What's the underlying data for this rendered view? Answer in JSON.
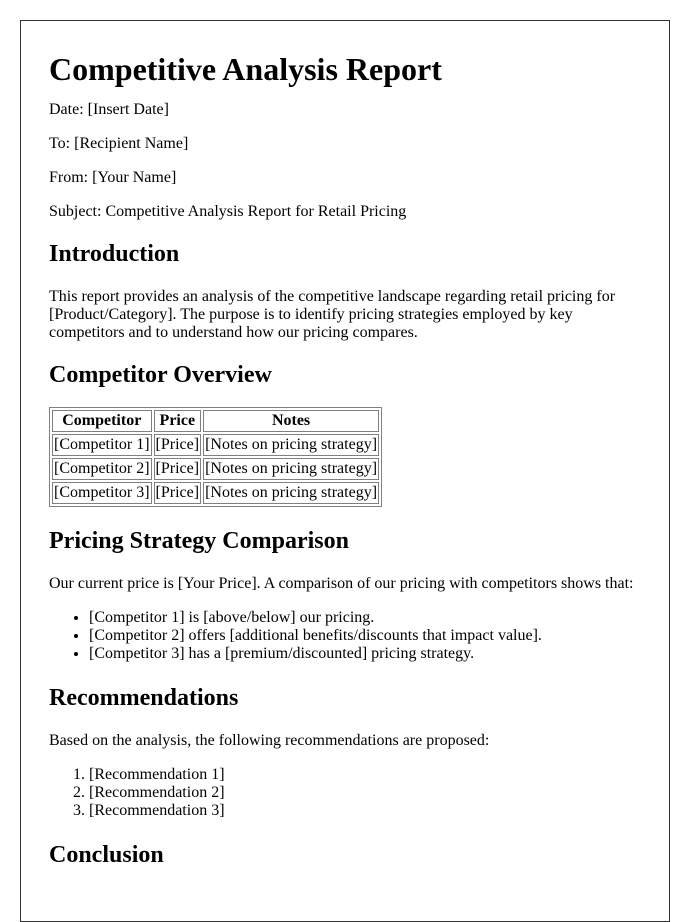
{
  "document": {
    "title": "Competitive Analysis Report",
    "meta": [
      {
        "label": "Date:",
        "value": "[Insert Date]"
      },
      {
        "label": "To:",
        "value": "[Recipient Name]"
      },
      {
        "label": "From:",
        "value": "[Your Name]"
      },
      {
        "label": "Subject:",
        "value": "Competitive Analysis Report for Retail Pricing"
      }
    ],
    "introduction": {
      "heading": "Introduction",
      "body": "This report provides an analysis of the competitive landscape regarding retail pricing for [Product/Category]. The purpose is to identify pricing strategies employed by key competitors and to understand how our pricing compares."
    },
    "competitor_overview": {
      "heading": "Competitor Overview",
      "table": {
        "headers": [
          "Competitor",
          "Price",
          "Notes"
        ],
        "rows": [
          [
            "[Competitor 1]",
            "[Price]",
            "[Notes on pricing strategy]"
          ],
          [
            "[Competitor 2]",
            "[Price]",
            "[Notes on pricing strategy]"
          ],
          [
            "[Competitor 3]",
            "[Price]",
            "[Notes on pricing strategy]"
          ]
        ]
      }
    },
    "pricing_comparison": {
      "heading": "Pricing Strategy Comparison",
      "body": "Our current price is [Your Price]. A comparison of our pricing with competitors shows that:",
      "bullets": [
        "[Competitor 1] is [above/below] our pricing.",
        "[Competitor 2] offers [additional benefits/discounts that impact value].",
        "[Competitor 3] has a [premium/discounted] pricing strategy."
      ]
    },
    "recommendations": {
      "heading": "Recommendations",
      "body": "Based on the analysis, the following recommendations are proposed:",
      "items": [
        "[Recommendation 1]",
        "[Recommendation 2]",
        "[Recommendation 3]"
      ]
    },
    "conclusion": {
      "heading": "Conclusion"
    }
  }
}
